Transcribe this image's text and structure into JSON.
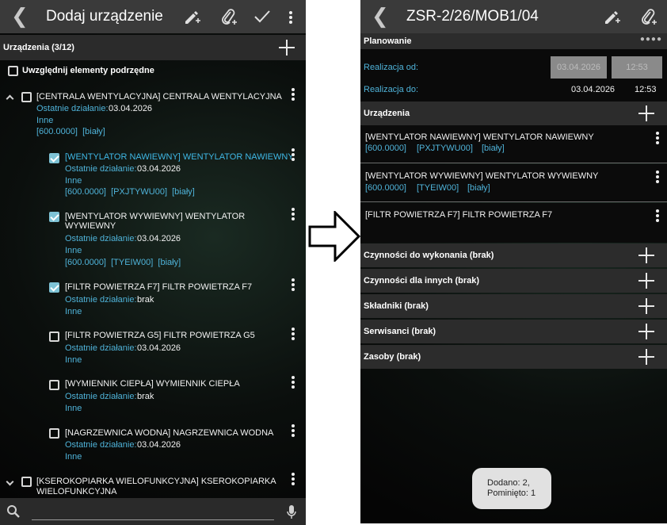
{
  "left": {
    "title": "Dodaj urządzenie",
    "devices_header": "Urządzenia (3/12)",
    "include_sub_label": "Uwzględnij elementy podrzędne",
    "items": [
      {
        "title": "[CENTRALA WENTYLACYJNA] CENTRALA WENTYLACYJNA",
        "last_label": "Ostatnie działanie:",
        "last_value": "03.04.2026",
        "category": "Inne",
        "tags": "[600.0000]  [biały]",
        "checked": false
      },
      {
        "title": "[WENTYLATOR NAWIEWNY] WENTYLATOR NAWIEWNY",
        "last_label": "Ostatnie działanie:",
        "last_value": "03.04.2026",
        "category": "Inne",
        "tags": "[600.0000]  [PXJTYWU00]  [biały]",
        "checked": true
      },
      {
        "title_line1": "[WENTYLATOR WYWIEWNY] WENTYLATOR",
        "title_line2": "WYWIEWNY",
        "last_label": "Ostatnie działanie:",
        "last_value": "03.04.2026",
        "category": "Inne",
        "tags": "[600.0000]  [TYEIW00]  [biały]",
        "checked": true
      },
      {
        "title": "[FILTR POWIETRZA F7] FILTR POWIETRZA F7",
        "last_label": "Ostatnie działanie:",
        "last_value": "brak",
        "category": "Inne",
        "checked": true
      },
      {
        "title": "[FILTR POWIETRZA G5] FILTR POWIETRZA G5",
        "last_label": "Ostatnie działanie:",
        "last_value": "03.04.2026",
        "category": "Inne",
        "checked": false
      },
      {
        "title": "[WYMIENNIK CIEPŁA] WYMIENNIK CIEPŁA",
        "last_label": "Ostatnie działanie:",
        "last_value": "brak",
        "category": "Inne",
        "checked": false
      },
      {
        "title": "[NAGRZEWNICA WODNA] NAGRZEWNICA WODNA",
        "last_label": "Ostatnie działanie:",
        "last_value": "03.04.2026",
        "category": "Inne",
        "checked": false
      },
      {
        "title_line1": "[KSEROKOPIARKA WIELOFUNKCYJNA] KSEROKOPIARKA",
        "title_line2": "WIELOFUNKCYJNA",
        "checked": false
      }
    ]
  },
  "right": {
    "title": "ZSR-2/26/MOB1/04",
    "planning_header": "Planowanie",
    "realization_from_label": "Realizacja od:",
    "realization_from_date": "03.04.2026",
    "realization_from_time": "12:53",
    "realization_to_label": "Realizacja do:",
    "realization_to_date": "03.04.2026",
    "realization_to_time": "12:53",
    "devices_header": "Urządzenia",
    "devices": [
      {
        "title": "[WENTYLATOR NAWIEWNY] WENTYLATOR NAWIEWNY",
        "tag1": "[600.0000]",
        "tag2": "[PXJTYWU00]",
        "tag3": "[biały]"
      },
      {
        "title": "[WENTYLATOR WYWIEWNY] WENTYLATOR WYWIEWNY",
        "tag1": "[600.0000]",
        "tag2": "[TYEIW00]",
        "tag3": "[biały]"
      },
      {
        "title": "[FILTR POWIETRZA F7] FILTR POWIETRZA F7"
      }
    ],
    "sections": [
      "Czynności do wykonania (brak)",
      "Czynności dla innych (brak)",
      "Składniki (brak)",
      "Serwisanci (brak)",
      "Zasoby (brak)"
    ],
    "toast_line1": "Dodano: 2,",
    "toast_line2": "Pominięto: 1"
  },
  "colors": {
    "accent_blue": "#4fb3d9",
    "selected_title": "#3fb8e6",
    "checkbox_checked": "#7ec3d6",
    "toolbar": "#3a3a3a"
  },
  "icons": {
    "back": "chevron-left-icon",
    "edit": "pencil-add-icon",
    "attach": "paperclip-add-icon",
    "confirm": "checkmark-icon",
    "menu": "more-vert-icon",
    "search": "search-icon",
    "mic": "microphone-icon",
    "arrow": "arrow-right-icon"
  }
}
